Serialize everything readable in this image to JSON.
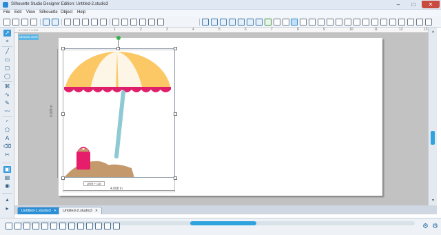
{
  "window": {
    "title": "Silhouette Studio Designer Edition: Untitled-2.studio3",
    "minimize": "–",
    "maximize": "□",
    "close": "✕"
  },
  "menu": [
    "File",
    "Edit",
    "View",
    "Silhouette",
    "Object",
    "Help"
  ],
  "ruler": {
    "top_numbers": [
      "1",
      "2",
      "3",
      "4",
      "5",
      "6",
      "7",
      "8",
      "9",
      "10",
      "11",
      "12",
      "13"
    ],
    "coords": "X 7.026  Y 0.451"
  },
  "canvas": {
    "view_label": "DESIGN VIEW",
    "width_label": "4.008  in",
    "height_label": "4.929  in",
    "popup_label": "print + cut"
  },
  "tabs": [
    {
      "label": "Untitled-1.studio3",
      "close": "✕"
    },
    {
      "label": "Untitled-2.studio3",
      "close": "✕"
    }
  ],
  "colors": {
    "umbrella_yellow": "#fbc865",
    "umbrella_cream": "#fdf5e6",
    "umbrella_scallop": "#e01f6a",
    "pole": "#8ec9d4",
    "sand": "#c49a6c",
    "bucket": "#e51d6a",
    "accent": "#2ea3dd"
  }
}
